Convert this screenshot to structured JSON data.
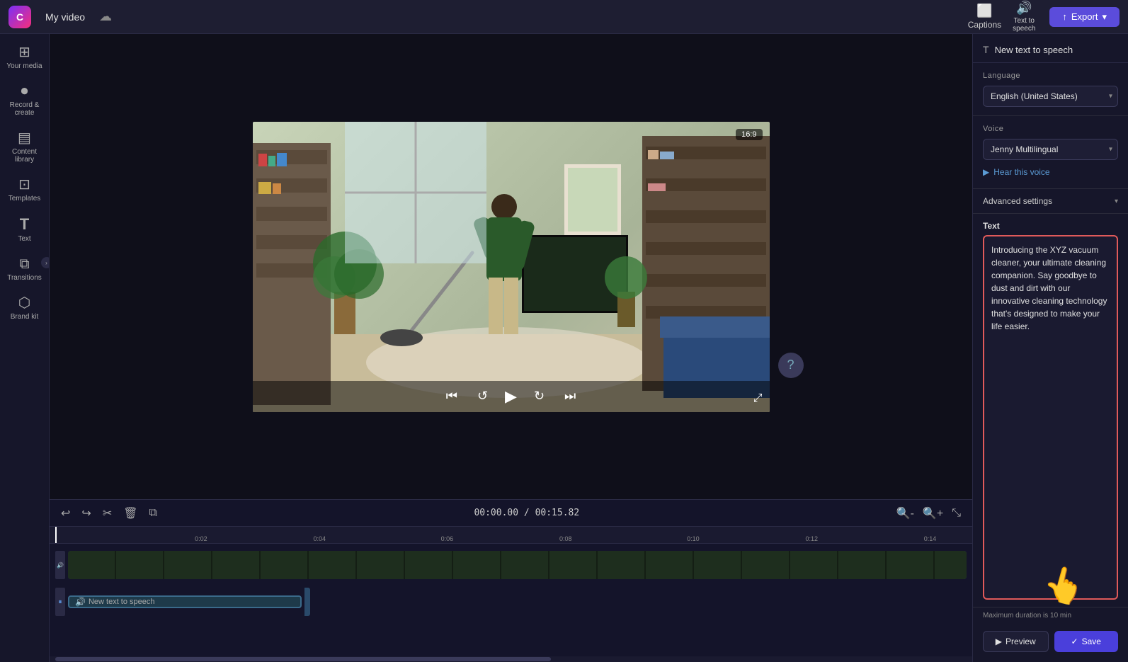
{
  "topbar": {
    "app_logo": "C",
    "project_title": "My video",
    "export_label": "Export",
    "captions_label": "Captions",
    "tts_label": "Text to speech"
  },
  "sidebar": {
    "items": [
      {
        "id": "your-media",
        "label": "Your media",
        "icon": "⊞"
      },
      {
        "id": "record-create",
        "label": "Record &\ncreate",
        "icon": "⏺"
      },
      {
        "id": "content-library",
        "label": "Content library",
        "icon": "▤"
      },
      {
        "id": "templates",
        "label": "Templates",
        "icon": "⊡"
      },
      {
        "id": "text",
        "label": "Text",
        "icon": "T"
      },
      {
        "id": "transitions",
        "label": "Transitions",
        "icon": "⧉"
      },
      {
        "id": "brand-kit",
        "label": "Brand kit",
        "icon": "⬡"
      }
    ]
  },
  "video": {
    "aspect_ratio": "16:9",
    "timecode_current": "00:00.00",
    "timecode_total": "00:15.82"
  },
  "timeline": {
    "ruler_marks": [
      "0:02",
      "0:04",
      "0:06",
      "0:08",
      "0:10",
      "0:12",
      "0:14"
    ],
    "track_label": "New text to speech"
  },
  "tts_panel": {
    "header_icon": "T",
    "header_title": "New text to speech",
    "language_label": "Language",
    "language_value": "English (United States)",
    "voice_label": "Voice",
    "voice_value": "Jenny Multilingual",
    "hear_voice_label": "Hear this voice",
    "advanced_settings_label": "Advanced settings",
    "text_section_label": "Text",
    "text_content": "Introducing the XYZ vacuum cleaner, your ultimate cleaning companion. Say goodbye to dust and dirt with our innovative cleaning technology that's designed to make your life easier.",
    "max_duration_note": "Maximum duration is 10 min",
    "preview_label": "Preview",
    "save_label": "Save"
  }
}
